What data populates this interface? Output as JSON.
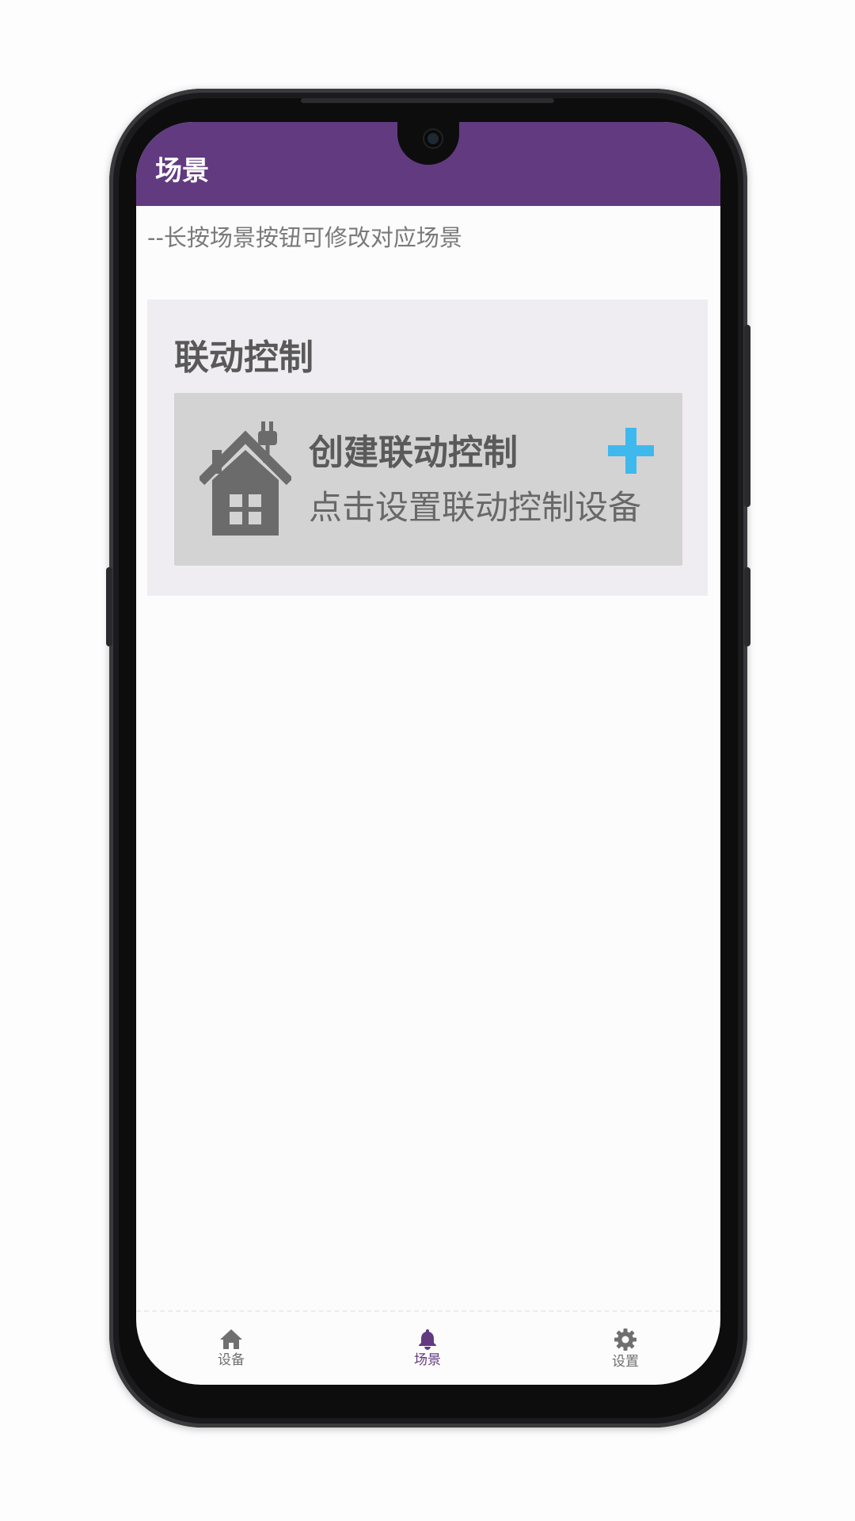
{
  "app": {
    "title": "场景"
  },
  "hint": "--长按场景按钮可修改对应场景",
  "card": {
    "title": "联动控制",
    "create": {
      "title": "创建联动控制",
      "subtitle": "点击设置联动控制设备",
      "icon": "house-plug-icon",
      "action_icon": "plus-icon"
    }
  },
  "bottom_nav": {
    "active": "场景",
    "items": [
      {
        "label": "设备",
        "icon": "home-icon"
      },
      {
        "label": "场景",
        "icon": "bell-icon"
      },
      {
        "label": "设置",
        "icon": "gear-icon"
      }
    ]
  },
  "colors": {
    "primary": "#623a80",
    "plus": "#3fb8ee",
    "card_bg": "#efedf2",
    "create_bg": "#d3d3d3"
  }
}
